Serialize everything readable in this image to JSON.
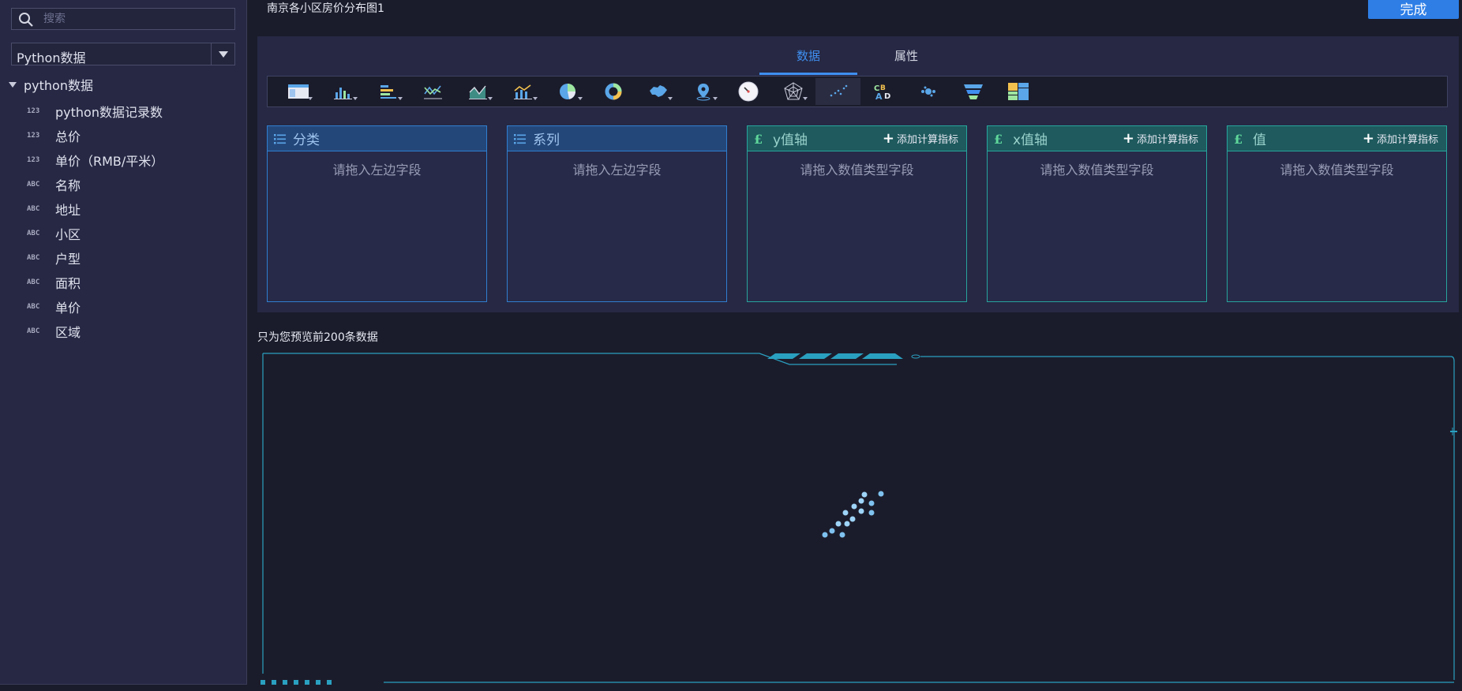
{
  "sidebar": {
    "search_placeholder": "搜索",
    "source_select": "Python数据",
    "tree_root": "python数据",
    "fields": [
      {
        "type": "123",
        "label": "python数据记录数"
      },
      {
        "type": "123",
        "label": "总价"
      },
      {
        "type": "123",
        "label": "单价（RMB/平米）"
      },
      {
        "type": "ABC",
        "label": "名称"
      },
      {
        "type": "ABC",
        "label": "地址"
      },
      {
        "type": "ABC",
        "label": "小区"
      },
      {
        "type": "ABC",
        "label": "户型"
      },
      {
        "type": "ABC",
        "label": "面积"
      },
      {
        "type": "ABC",
        "label": "单价"
      },
      {
        "type": "ABC",
        "label": "区域"
      }
    ]
  },
  "header": {
    "chart_title": "南京各小区房价分布图1",
    "done_label": "完成"
  },
  "tabs": {
    "data": "数据",
    "props": "属性"
  },
  "toolbar": {
    "chart_types": [
      "table-icon",
      "bar-chart-icon",
      "horizontal-bar-icon",
      "line-chart-icon",
      "area-chart-icon",
      "combo-chart-icon",
      "pie-chart-icon",
      "donut-chart-icon",
      "china-map-icon",
      "location-pin-icon",
      "gauge-icon",
      "radar-chart-icon",
      "scatter-chart-icon",
      "word-cloud-icon",
      "bubble-chart-icon",
      "funnel-chart-icon",
      "treemap-icon"
    ],
    "selected": "scatter-chart-icon"
  },
  "zones": {
    "category": {
      "title": "分类",
      "hint": "请拖入左边字段"
    },
    "series": {
      "title": "系列",
      "hint": "请拖入左边字段"
    },
    "y_axis": {
      "title": "y值轴",
      "hint": "请拖入数值类型字段",
      "add": "添加计算指标"
    },
    "x_axis": {
      "title": "x值轴",
      "hint": "请拖入数值类型字段",
      "add": "添加计算指标"
    },
    "value": {
      "title": "值",
      "hint": "请拖入数值类型字段",
      "add": "添加计算指标"
    }
  },
  "preview": {
    "note": "只为您预览前200条数据"
  },
  "colors": {
    "accent": "#2e7ee6",
    "dimension_border": "#2f7ed0",
    "measure_border": "#27a59d",
    "frame": "#2aa0c0"
  }
}
